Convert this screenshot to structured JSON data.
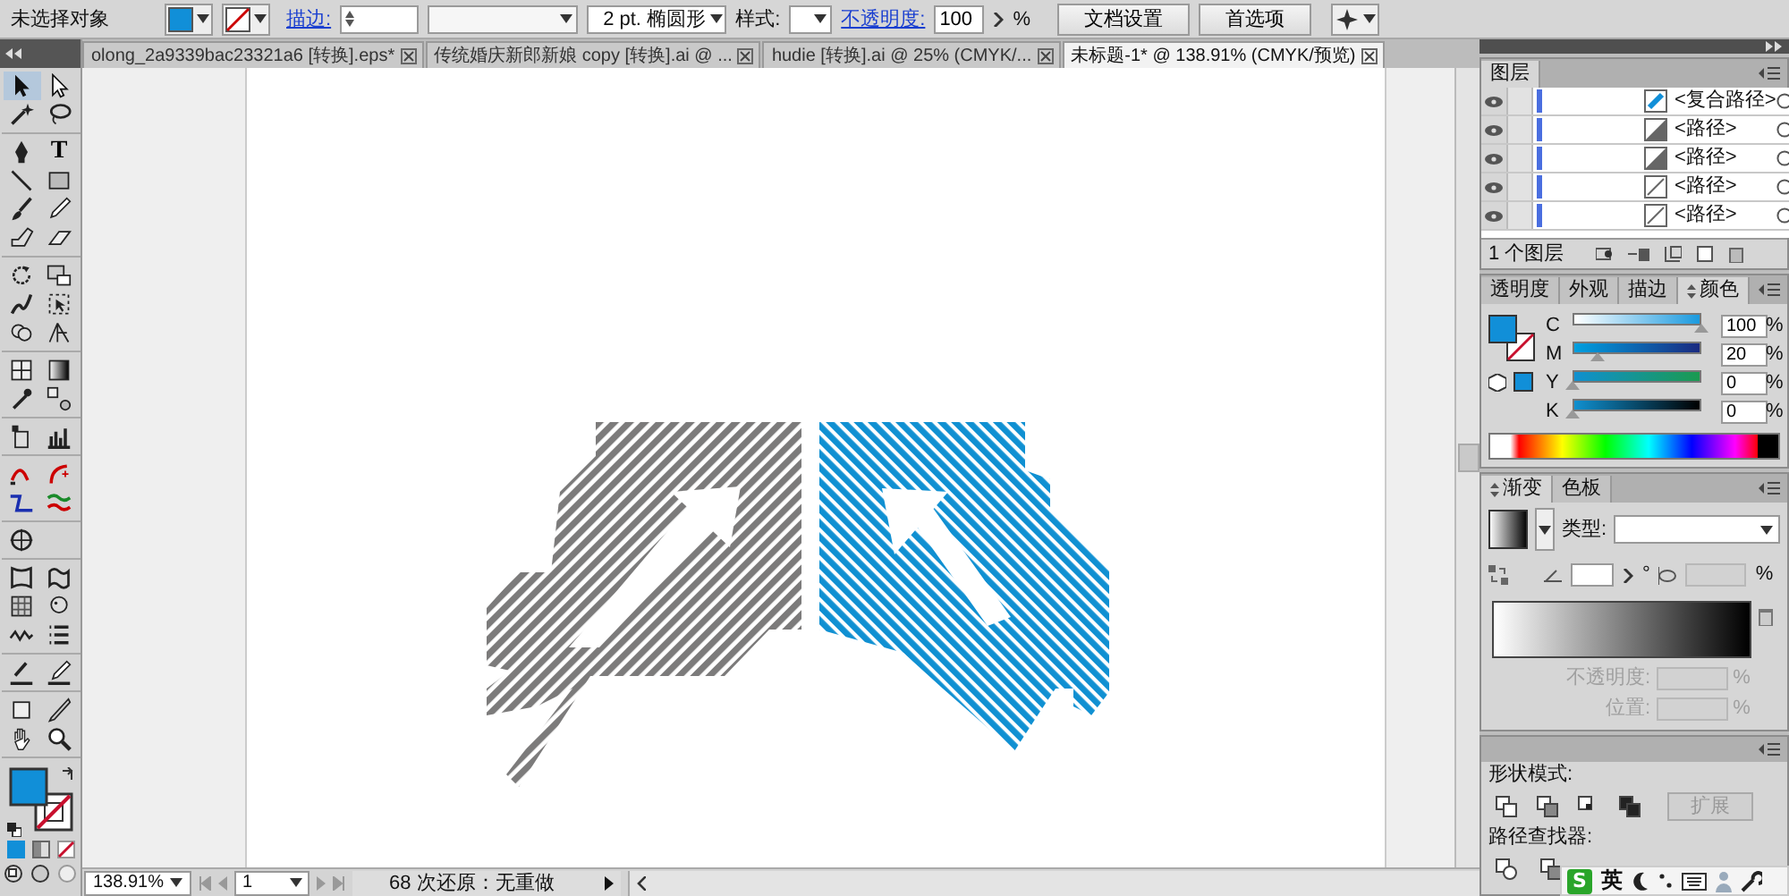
{
  "control_bar": {
    "selection": "未选择对象",
    "stroke_link": "描边:",
    "brush": "2 pt. 椭圆形",
    "style_label": "样式:",
    "opacity_link": "不透明度:",
    "opacity": "100",
    "opacity_unit": "%",
    "buttons": [
      "文档设置",
      "首选项"
    ]
  },
  "tabs": [
    {
      "label": "olong_2a9339bac23321a6 [转换].eps*",
      "selected": false
    },
    {
      "label": "传统婚庆新郎新娘 copy [转换].ai @ ...",
      "selected": false
    },
    {
      "label": "hudie [转换].ai @ 25% (CMYK/...",
      "selected": false
    },
    {
      "label": "未标题-1* @ 138.91% (CMYK/预览)",
      "selected": true
    }
  ],
  "toolbox": {
    "groups": [
      [
        {
          "kind": "selection",
          "selected": true
        },
        {
          "kind": "direct",
          "selected": false
        },
        {
          "kind": "wand",
          "selected": false
        },
        {
          "kind": "lasso",
          "selected": false
        }
      ],
      [
        {
          "kind": "pen",
          "selected": false
        },
        {
          "kind": "type",
          "glyph": "T",
          "selected": false
        },
        {
          "kind": "line",
          "selected": false
        },
        {
          "kind": "rect",
          "selected": false
        },
        {
          "kind": "brush",
          "selected": false
        },
        {
          "kind": "pencil",
          "selected": false
        },
        {
          "kind": "blob",
          "selected": false
        },
        {
          "kind": "eraser",
          "selected": false
        }
      ],
      [
        {
          "kind": "rotate",
          "selected": false
        },
        {
          "kind": "scale",
          "selected": false
        },
        {
          "kind": "warp",
          "selected": false
        },
        {
          "kind": "free",
          "selected": false
        },
        {
          "kind": "builder",
          "selected": false
        },
        {
          "kind": "perspective",
          "selected": false
        }
      ],
      [
        {
          "kind": "mesh",
          "selected": false
        },
        {
          "kind": "gradient",
          "selected": false
        },
        {
          "kind": "eyedropper",
          "selected": false
        },
        {
          "kind": "blend",
          "selected": false
        }
      ],
      [
        {
          "kind": "symbol",
          "selected": false
        },
        {
          "kind": "graph",
          "selected": false
        }
      ],
      [
        {
          "kind": "curve_red",
          "selected": false
        },
        {
          "kind": "curve_red2",
          "selected": false
        },
        {
          "kind": "zig_blue",
          "selected": false
        },
        {
          "kind": "wave_green",
          "selected": false
        }
      ],
      [
        {
          "kind": "crosshair",
          "selected": false
        }
      ],
      [
        {
          "kind": "envelope",
          "selected": false
        },
        {
          "kind": "wave",
          "selected": false
        },
        {
          "kind": "meshgrid",
          "selected": false
        },
        {
          "kind": "puppet",
          "selected": false
        },
        {
          "kind": "wiggle",
          "selected": false
        },
        {
          "kind": "list",
          "selected": false
        }
      ],
      [
        {
          "kind": "measure",
          "selected": false
        },
        {
          "kind": "pencil2",
          "selected": false
        }
      ],
      [
        {
          "kind": "artboard",
          "selected": false
        },
        {
          "kind": "knife",
          "selected": false
        },
        {
          "kind": "hand",
          "selected": false
        },
        {
          "kind": "zoom",
          "selected": false
        }
      ]
    ]
  },
  "layers_panel": {
    "title": "图层",
    "rows": [
      {
        "name": "<复合路径>",
        "kind": "compound",
        "visible": true
      },
      {
        "name": "<路径>",
        "kind": "half",
        "visible": true
      },
      {
        "name": "<路径>",
        "kind": "half",
        "visible": true
      },
      {
        "name": "<路径>",
        "kind": "line",
        "visible": true
      },
      {
        "name": "<路径>",
        "kind": "line",
        "visible": true
      }
    ],
    "footer": "1 个图层"
  },
  "color_panel": {
    "tabs": [
      {
        "label": "透明度",
        "selected": false
      },
      {
        "label": "外观",
        "selected": false
      },
      {
        "label": "描边",
        "selected": false
      },
      {
        "label": "颜色",
        "selected": true
      }
    ],
    "channels": [
      {
        "name": "C",
        "level": 1,
        "value": "100",
        "unit": "%"
      },
      {
        "name": "M",
        "level": 0.2,
        "value": "20",
        "unit": "%"
      },
      {
        "name": "Y",
        "level": 0,
        "value": "0",
        "unit": "%"
      },
      {
        "name": "K",
        "level": 0,
        "value": "0",
        "unit": "%"
      }
    ]
  },
  "gradient_panel": {
    "tabs": [
      {
        "label": "渐变",
        "selected": true
      },
      {
        "label": "色板",
        "selected": false
      }
    ],
    "type_label": "类型:",
    "angle_unit": "°",
    "ratio_unit": "%",
    "opacity": {
      "label": "不透明度:",
      "unit": "%",
      "disabled": true
    },
    "position": {
      "label": "位置:",
      "unit": "%",
      "disabled": true
    }
  },
  "pathfinder_panel": {
    "shape_modes_label": "形状模式:",
    "expand_button": {
      "label": "扩展",
      "disabled": true
    },
    "pathfinders_label": "路径查找器:"
  },
  "status_bar": {
    "zoom": "138.91%",
    "page": "1",
    "status": "68 次还原：无重做"
  },
  "ime_bar": {
    "logo": "S",
    "mode": "英"
  }
}
